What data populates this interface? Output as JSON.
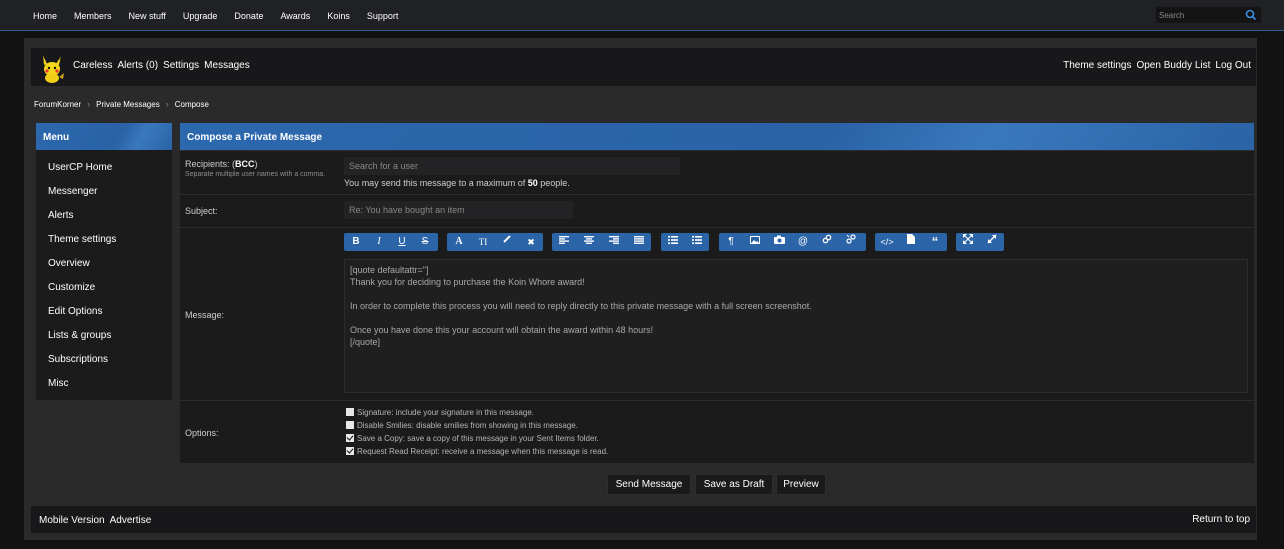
{
  "topnav": {
    "items": [
      "Home",
      "Members",
      "New stuff",
      "Upgrade",
      "Donate",
      "Awards",
      "Koins",
      "Support"
    ],
    "search_placeholder": "Search",
    "accent": "#2c64a8"
  },
  "userbar": {
    "left": [
      "Careless",
      "Alerts (0)",
      "Settings",
      "Messages"
    ],
    "right": [
      "Theme settings",
      "Open Buddy List",
      "Log Out"
    ]
  },
  "breadcrumb": [
    "ForumKorner",
    "Private Messages",
    "Compose"
  ],
  "sidebar": {
    "title": "Menu",
    "items": [
      "UserCP Home",
      "Messenger",
      "Alerts",
      "Theme settings",
      "Overview",
      "Customize",
      "Edit Options",
      "Lists & groups",
      "Subscriptions",
      "Misc"
    ]
  },
  "compose": {
    "title": "Compose a Private Message",
    "recipients": {
      "label": "Recipients: (",
      "bcc": "BCC",
      "label_close": ")",
      "hint": "Separate multiple user names with a comma.",
      "placeholder": "Search for a user",
      "limit_pre": "You may send this message to a maximum of ",
      "limit_num": "50",
      "limit_post": " people."
    },
    "subject": {
      "label": "Subject:",
      "placeholder": "Re: You have bought an item"
    },
    "message": {
      "label": "Message:",
      "body": "[quote defaultattr=\"]\nThank you for deciding to purchase the Koin Whore award!\n\nIn order to complete this process you will need to reply directly to this private message with a full screen screenshot.\n\nOnce you have done this your account will obtain the award within 48 hours!\n[/quote]"
    },
    "options": {
      "label": "Options:",
      "items": [
        {
          "text": "Signature: include your signature in this message.",
          "checked": false
        },
        {
          "text": "Disable Smilies: disable smilies from showing in this message.",
          "checked": false
        },
        {
          "text": "Save a Copy: save a copy of this message in your Sent Items folder.",
          "checked": true
        },
        {
          "text": " Request Read Receipt: receive a message when this message is read.",
          "checked": true
        }
      ]
    }
  },
  "toolbar": {
    "bold": "B",
    "italic": "I",
    "underline": "U",
    "strike": "S",
    "color": "A",
    "size": "TI"
  },
  "buttons": {
    "send": "Send Message",
    "draft": "Save as Draft",
    "preview": "Preview"
  },
  "footer": {
    "left": [
      "Mobile Version",
      "Advertise"
    ],
    "right": "Return to top"
  }
}
